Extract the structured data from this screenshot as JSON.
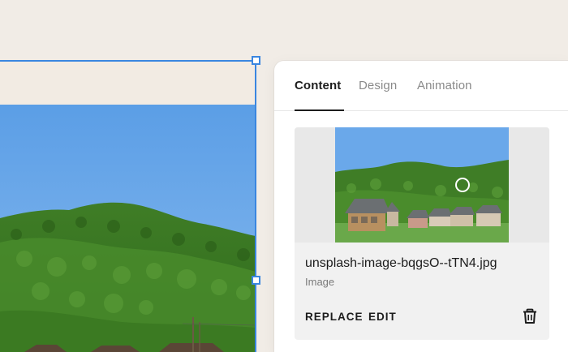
{
  "panel": {
    "tabs": [
      {
        "label": "Content",
        "active": true
      },
      {
        "label": "Design",
        "active": false
      },
      {
        "label": "Animation",
        "active": false
      }
    ]
  },
  "image_card": {
    "filename": "unsplash-image-bqgsO--tTN4.jpg",
    "type_label": "Image",
    "replace_label": "REPLACE",
    "edit_label": "EDIT",
    "delete_icon": "trash-icon"
  },
  "colors": {
    "selection": "#3a86e0",
    "page_background": "#f1ece6",
    "panel_background": "#ffffff",
    "card_background": "#f1f1f1"
  }
}
